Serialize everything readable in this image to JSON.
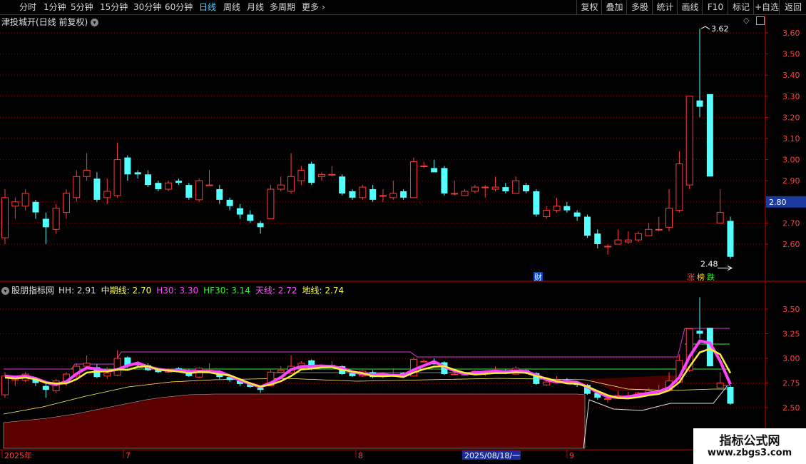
{
  "toolbar": {
    "periods": [
      "分时",
      "1分钟",
      "5分钟",
      "15分钟",
      "30分钟",
      "60分钟",
      "日线",
      "周线",
      "月线",
      "多周期",
      "更多"
    ],
    "active_period": "日线",
    "right_buttons": [
      "复权",
      "叠加",
      "多股",
      "统计",
      "画线",
      "F10",
      "标记",
      "+自选",
      "返回"
    ]
  },
  "main": {
    "title": "津投城开(日线 前复权)",
    "price_ticks": [
      "3.60",
      "3.50",
      "3.40",
      "3.30",
      "3.20",
      "3.10",
      "3.00",
      "2.90",
      "2.80",
      "2.70",
      "2.60"
    ],
    "current_price": "2.80",
    "high_label": "3.62",
    "low_label": "2.48",
    "markers": {
      "cai": "财",
      "zhang": "涨",
      "bang": "榜",
      "die": "跌"
    }
  },
  "indicator": {
    "name": "股朋指标网",
    "values": [
      {
        "label": "HH:",
        "value": "2.91",
        "color": "#dcdcdc"
      },
      {
        "label": "中期线:",
        "value": "2.70",
        "color": "#ffff55"
      },
      {
        "label": "H30:",
        "value": "3.30",
        "color": "#ff44ff"
      },
      {
        "label": "HF30:",
        "value": "3.14",
        "color": "#33ee33"
      },
      {
        "label": "天线:",
        "value": "2.72",
        "color": "#ff55ff"
      },
      {
        "label": "地线:",
        "value": "2.74",
        "color": "#ffff33"
      }
    ],
    "ticks": [
      "3.50",
      "3.25",
      "3.00",
      "2.75",
      "2.50"
    ]
  },
  "date_axis": {
    "labels": [
      "2025年",
      "7",
      "8",
      "9"
    ],
    "cursor_date": "2025/08/18/一"
  },
  "watermark": {
    "title": "指标公式网",
    "url": "www.zbgs3.com"
  },
  "colors": {
    "up": "#ff3b3b",
    "down": "#54ffff",
    "grid": "#8b0000",
    "axis": "#c00000"
  },
  "chart_data": {
    "type": "candlestick",
    "ylim": [
      2.48,
      3.65
    ],
    "indicator_ylim": [
      2.45,
      3.7
    ],
    "candles": [
      {
        "o": 2.63,
        "c": 2.82,
        "h": 2.86,
        "l": 2.6
      },
      {
        "o": 2.78,
        "c": 2.8,
        "h": 2.82,
        "l": 2.72
      },
      {
        "o": 2.78,
        "c": 2.84,
        "h": 2.86,
        "l": 2.76
      },
      {
        "o": 2.8,
        "c": 2.75,
        "h": 2.81,
        "l": 2.72
      },
      {
        "o": 2.72,
        "c": 2.68,
        "h": 2.75,
        "l": 2.6
      },
      {
        "o": 2.67,
        "c": 2.77,
        "h": 2.79,
        "l": 2.65
      },
      {
        "o": 2.75,
        "c": 2.84,
        "h": 2.86,
        "l": 2.72
      },
      {
        "o": 2.82,
        "c": 2.92,
        "h": 2.95,
        "l": 2.8
      },
      {
        "o": 2.92,
        "c": 2.95,
        "h": 3.03,
        "l": 2.9
      },
      {
        "o": 2.91,
        "c": 2.81,
        "h": 2.94,
        "l": 2.8
      },
      {
        "o": 2.82,
        "c": 2.85,
        "h": 2.91,
        "l": 2.79
      },
      {
        "o": 2.83,
        "c": 3.0,
        "h": 3.08,
        "l": 2.82
      },
      {
        "o": 3.01,
        "c": 2.93,
        "h": 3.02,
        "l": 2.9
      },
      {
        "o": 2.94,
        "c": 2.93,
        "h": 2.95,
        "l": 2.91
      },
      {
        "o": 2.93,
        "c": 2.88,
        "h": 2.95,
        "l": 2.87
      },
      {
        "o": 2.89,
        "c": 2.86,
        "h": 2.9,
        "l": 2.85
      },
      {
        "o": 2.86,
        "c": 2.89,
        "h": 2.9,
        "l": 2.85
      },
      {
        "o": 2.9,
        "c": 2.89,
        "h": 2.91,
        "l": 2.88
      },
      {
        "o": 2.88,
        "c": 2.82,
        "h": 2.89,
        "l": 2.81
      },
      {
        "o": 2.81,
        "c": 2.9,
        "h": 2.91,
        "l": 2.8
      },
      {
        "o": 2.88,
        "c": 2.88,
        "h": 2.95,
        "l": 2.88
      },
      {
        "o": 2.86,
        "c": 2.81,
        "h": 2.88,
        "l": 2.79
      },
      {
        "o": 2.81,
        "c": 2.78,
        "h": 2.82,
        "l": 2.76
      },
      {
        "o": 2.77,
        "c": 2.74,
        "h": 2.79,
        "l": 2.72
      },
      {
        "o": 2.74,
        "c": 2.71,
        "h": 2.76,
        "l": 2.7
      },
      {
        "o": 2.7,
        "c": 2.68,
        "h": 2.71,
        "l": 2.65
      },
      {
        "o": 2.72,
        "c": 2.86,
        "h": 2.88,
        "l": 2.72
      },
      {
        "o": 2.86,
        "c": 2.88,
        "h": 2.92,
        "l": 2.85
      },
      {
        "o": 2.85,
        "c": 2.92,
        "h": 3.03,
        "l": 2.84
      },
      {
        "o": 2.9,
        "c": 2.95,
        "h": 2.97,
        "l": 2.88
      },
      {
        "o": 2.98,
        "c": 2.89,
        "h": 2.99,
        "l": 2.88
      },
      {
        "o": 2.92,
        "c": 2.93,
        "h": 2.94,
        "l": 2.9
      },
      {
        "o": 2.93,
        "c": 2.93,
        "h": 2.97,
        "l": 2.92
      },
      {
        "o": 2.92,
        "c": 2.84,
        "h": 2.93,
        "l": 2.83
      },
      {
        "o": 2.85,
        "c": 2.82,
        "h": 2.86,
        "l": 2.81
      },
      {
        "o": 2.82,
        "c": 2.87,
        "h": 2.88,
        "l": 2.81
      },
      {
        "o": 2.86,
        "c": 2.81,
        "h": 2.88,
        "l": 2.8
      },
      {
        "o": 2.83,
        "c": 2.83,
        "h": 2.86,
        "l": 2.8
      },
      {
        "o": 2.82,
        "c": 2.84,
        "h": 2.9,
        "l": 2.81
      },
      {
        "o": 2.85,
        "c": 2.82,
        "h": 2.86,
        "l": 2.81
      },
      {
        "o": 2.82,
        "c": 2.99,
        "h": 3.01,
        "l": 2.82
      },
      {
        "o": 2.97,
        "c": 2.97,
        "h": 2.99,
        "l": 2.96
      },
      {
        "o": 2.96,
        "c": 2.94,
        "h": 3.0,
        "l": 2.94
      },
      {
        "o": 2.96,
        "c": 2.84,
        "h": 2.97,
        "l": 2.83
      },
      {
        "o": 2.84,
        "c": 2.84,
        "h": 2.9,
        "l": 2.83
      },
      {
        "o": 2.83,
        "c": 2.85,
        "h": 2.86,
        "l": 2.83
      },
      {
        "o": 2.85,
        "c": 2.87,
        "h": 2.88,
        "l": 2.84
      },
      {
        "o": 2.87,
        "c": 2.87,
        "h": 2.88,
        "l": 2.82
      },
      {
        "o": 2.86,
        "c": 2.87,
        "h": 2.92,
        "l": 2.85
      },
      {
        "o": 2.87,
        "c": 2.85,
        "h": 2.89,
        "l": 2.84
      },
      {
        "o": 2.84,
        "c": 2.9,
        "h": 2.92,
        "l": 2.84
      },
      {
        "o": 2.88,
        "c": 2.85,
        "h": 2.89,
        "l": 2.84
      },
      {
        "o": 2.85,
        "c": 2.74,
        "h": 2.86,
        "l": 2.73
      },
      {
        "o": 2.73,
        "c": 2.76,
        "h": 2.78,
        "l": 2.72
      },
      {
        "o": 2.76,
        "c": 2.78,
        "h": 2.82,
        "l": 2.75
      },
      {
        "o": 2.78,
        "c": 2.76,
        "h": 2.8,
        "l": 2.75
      },
      {
        "o": 2.75,
        "c": 2.73,
        "h": 2.76,
        "l": 2.71
      },
      {
        "o": 2.73,
        "c": 2.64,
        "h": 2.74,
        "l": 2.63
      },
      {
        "o": 2.65,
        "c": 2.6,
        "h": 2.67,
        "l": 2.58
      },
      {
        "o": 2.59,
        "c": 2.59,
        "h": 2.6,
        "l": 2.55
      },
      {
        "o": 2.6,
        "c": 2.62,
        "h": 2.67,
        "l": 2.6
      },
      {
        "o": 2.61,
        "c": 2.62,
        "h": 2.66,
        "l": 2.6
      },
      {
        "o": 2.62,
        "c": 2.65,
        "h": 2.66,
        "l": 2.61
      },
      {
        "o": 2.64,
        "c": 2.67,
        "h": 2.7,
        "l": 2.64
      },
      {
        "o": 2.67,
        "c": 2.67,
        "h": 2.73,
        "l": 2.66
      },
      {
        "o": 2.68,
        "c": 2.77,
        "h": 2.86,
        "l": 2.66
      },
      {
        "o": 2.76,
        "c": 2.98,
        "h": 3.04,
        "l": 2.75
      },
      {
        "o": 2.88,
        "c": 3.3,
        "h": 3.3,
        "l": 2.86
      },
      {
        "o": 3.28,
        "c": 3.25,
        "h": 3.62,
        "l": 3.2
      },
      {
        "o": 3.31,
        "c": 2.92,
        "h": 3.31,
        "l": 2.92
      },
      {
        "o": 2.7,
        "c": 2.75,
        "h": 2.86,
        "l": 2.7
      },
      {
        "o": 2.71,
        "c": 2.54,
        "h": 2.73,
        "l": 2.53
      }
    ]
  }
}
